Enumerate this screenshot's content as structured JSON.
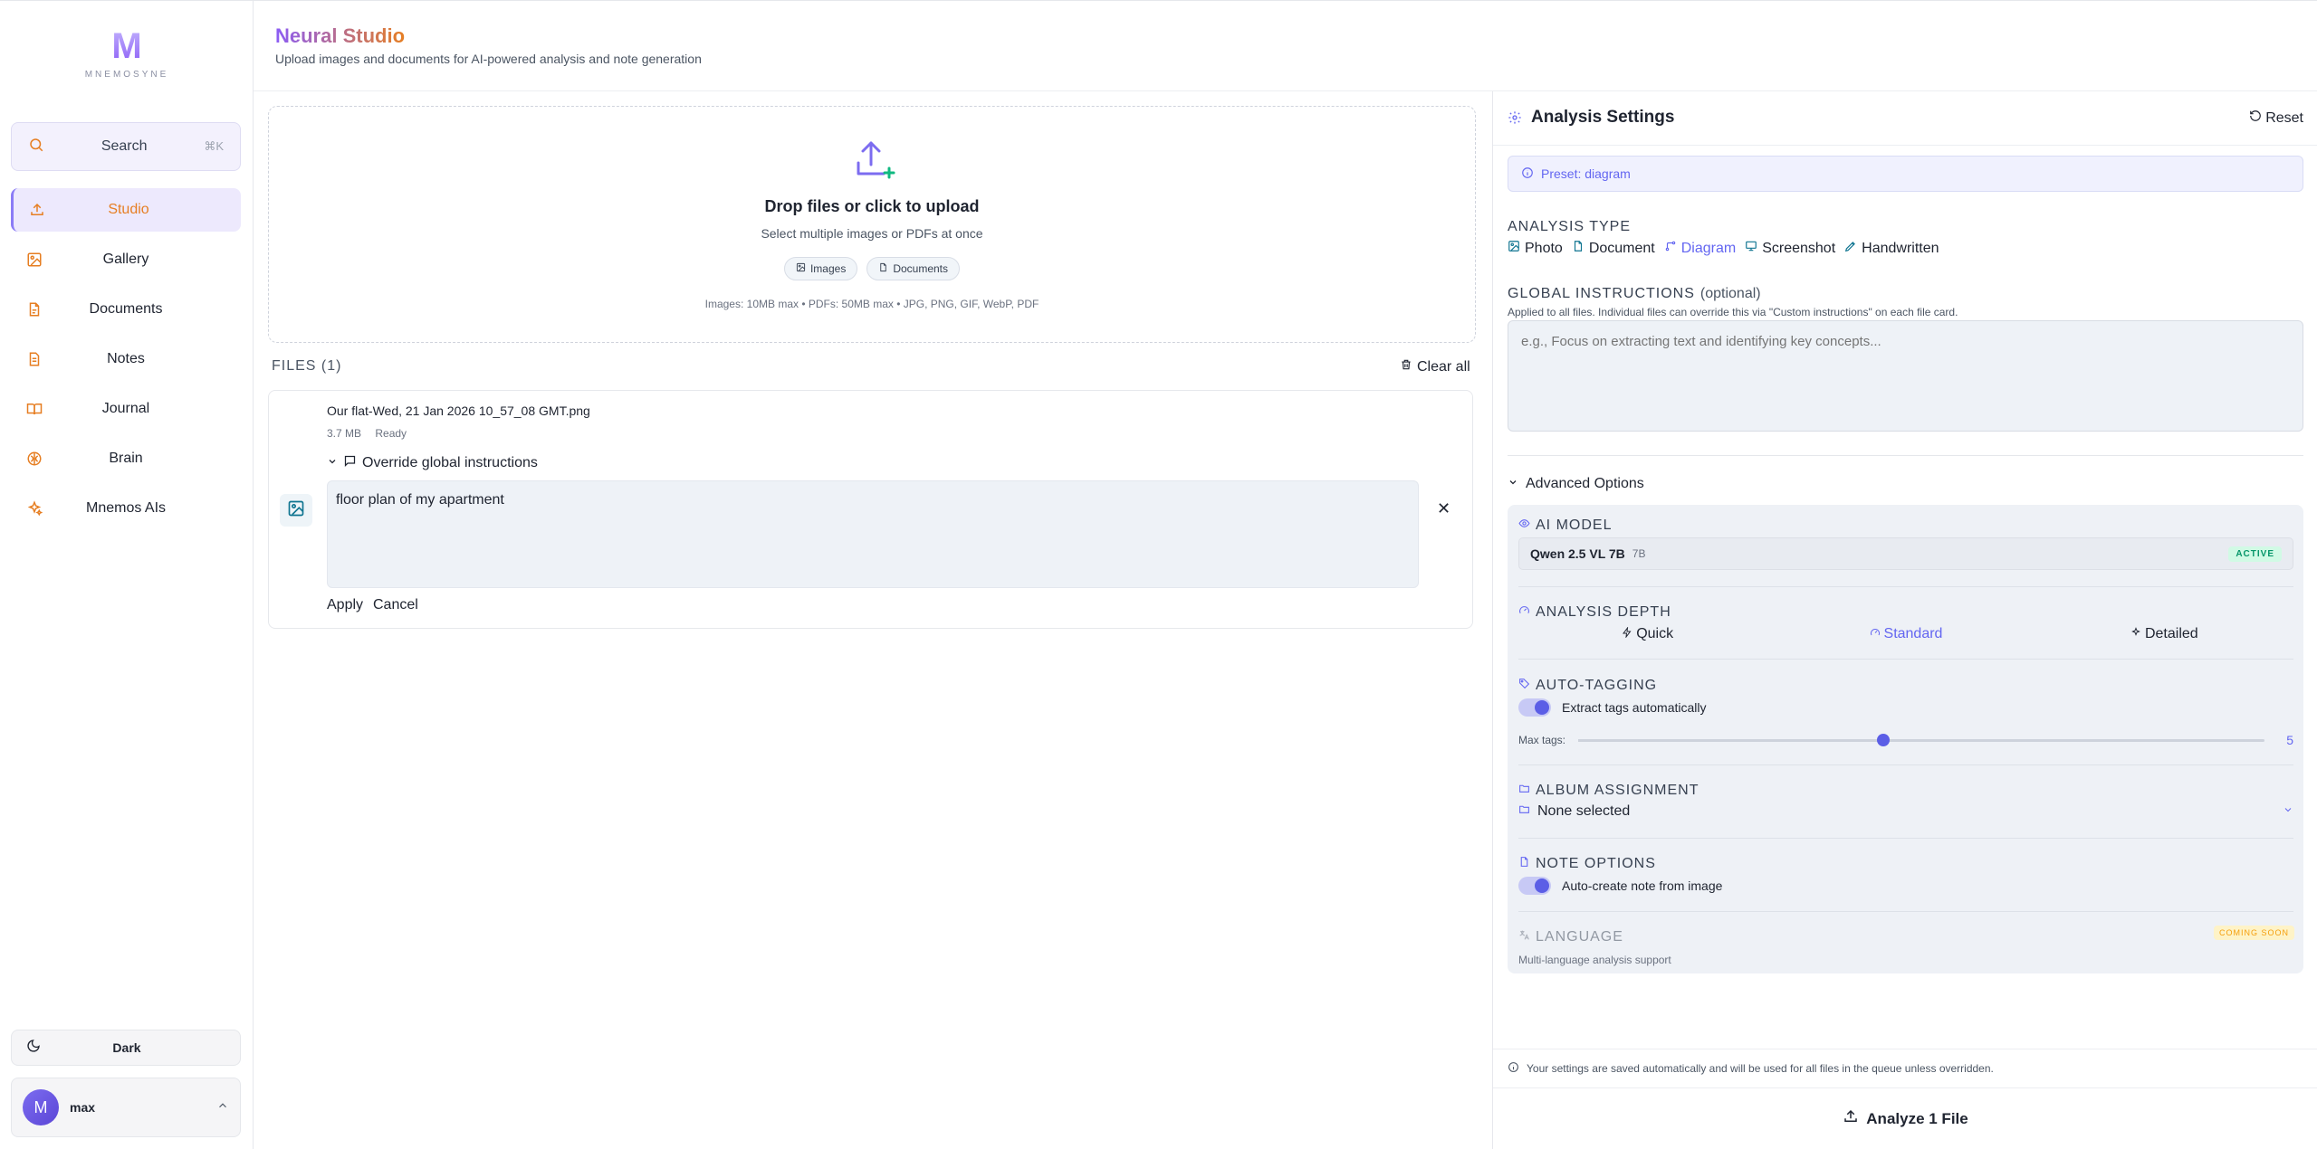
{
  "brand": {
    "logo_letter": "M",
    "wordmark": "MNEMOSYNE"
  },
  "sidebar": {
    "search_label": "Search",
    "search_shortcut": "⌘K",
    "items": [
      {
        "label": "Studio",
        "icon": "upload-icon"
      },
      {
        "label": "Gallery",
        "icon": "image-icon"
      },
      {
        "label": "Documents",
        "icon": "document-icon"
      },
      {
        "label": "Notes",
        "icon": "notes-icon"
      },
      {
        "label": "Journal",
        "icon": "book-icon"
      },
      {
        "label": "Brain",
        "icon": "brain-icon"
      },
      {
        "label": "Mnemos AIs",
        "icon": "sparkles-icon"
      }
    ],
    "active_item": "Studio",
    "theme_label": "Dark",
    "user": {
      "initial": "M",
      "name": "max"
    }
  },
  "header": {
    "title": "Neural Studio",
    "subtitle": "Upload images and documents for AI-powered analysis and note generation"
  },
  "upload": {
    "title": "Drop files or click to upload",
    "subtitle": "Select multiple images or PDFs at once",
    "chip_images": "Images",
    "chip_documents": "Documents",
    "limits": "Images: 10MB max • PDFs: 50MB max • JPG, PNG, GIF, WebP, PDF"
  },
  "files": {
    "header": "FILES (1)",
    "clear_all": "Clear all",
    "items": [
      {
        "name": "Our flat-Wed, 21 Jan 2026 10_57_08 GMT.png",
        "size": "3.7 MB",
        "status": "Ready",
        "override_label": "Override global instructions",
        "instructions": "floor plan of my apartment",
        "apply": "Apply",
        "cancel": "Cancel"
      }
    ]
  },
  "settings": {
    "title": "Analysis Settings",
    "reset": "Reset",
    "preset": "Preset: diagram",
    "analysis_type_label": "ANALYSIS TYPE",
    "types": [
      "Photo",
      "Document",
      "Diagram",
      "Screenshot",
      "Handwritten"
    ],
    "selected_type": "Diagram",
    "global_label": "GLOBAL INSTRUCTIONS",
    "global_optional": "(optional)",
    "global_help": "Applied to all files. Individual files can override this via \"Custom instructions\" on each file card.",
    "global_placeholder": "e.g., Focus on extracting text and identifying key concepts...",
    "advanced_label": "Advanced Options",
    "ai_model_label": "AI MODEL",
    "model_name": "Qwen 2.5 VL 7B",
    "model_size": "7B",
    "model_status": "ACTIVE",
    "depth_label": "ANALYSIS DEPTH",
    "depths": [
      "Quick",
      "Standard",
      "Detailed"
    ],
    "selected_depth": "Standard",
    "autotag_label": "AUTO-TAGGING",
    "autotag_toggle": "Extract tags automatically",
    "max_tags_label": "Max tags:",
    "max_tags_value": 5,
    "max_tags_min": 1,
    "max_tags_max": 10,
    "album_label": "ALBUM ASSIGNMENT",
    "album_value": "None selected",
    "note_label": "NOTE OPTIONS",
    "note_toggle": "Auto-create note from image",
    "language_label": "LANGUAGE",
    "language_badge": "COMING SOON",
    "language_sub": "Multi-language analysis support",
    "footnote": "Your settings are saved automatically and will be used for all files in the queue unless overridden.",
    "analyze_button": "Analyze 1 File"
  },
  "colors": {
    "accent": "#6366f1",
    "brand_orange": "#e67e22",
    "active_badge": "#059669"
  }
}
